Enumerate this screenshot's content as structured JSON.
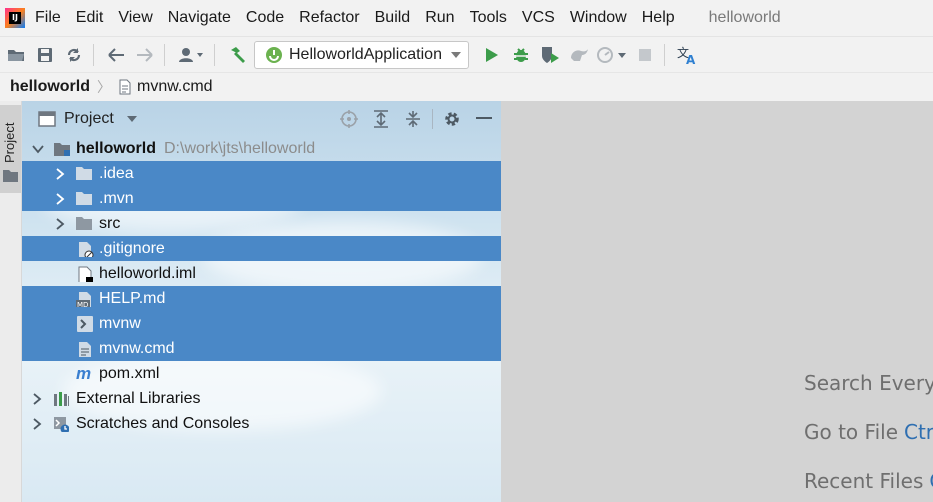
{
  "menubar": {
    "items": [
      "File",
      "Edit",
      "View",
      "Navigate",
      "Code",
      "Refactor",
      "Build",
      "Run",
      "Tools",
      "VCS",
      "Window",
      "Help"
    ],
    "window_title": "helloworld"
  },
  "toolbar": {
    "run_config": "HelloworldApplication"
  },
  "breadcrumb": {
    "project": "helloworld",
    "file": "mvnw.cmd"
  },
  "side_strip": {
    "tab_label": "Project"
  },
  "project_panel": {
    "title": "Project",
    "root": {
      "name": "helloworld",
      "path": "D:\\work\\jts\\helloworld"
    },
    "items": [
      {
        "label": ".idea",
        "type": "folder",
        "selected": true
      },
      {
        "label": ".mvn",
        "type": "folder",
        "selected": true
      },
      {
        "label": "src",
        "type": "folder",
        "selected": false
      },
      {
        "label": ".gitignore",
        "type": "gitignore",
        "selected": true
      },
      {
        "label": "helloworld.iml",
        "type": "iml",
        "selected": false
      },
      {
        "label": "HELP.md",
        "type": "md",
        "selected": true
      },
      {
        "label": "mvnw",
        "type": "script",
        "selected": true
      },
      {
        "label": "mvnw.cmd",
        "type": "text",
        "selected": true
      },
      {
        "label": "pom.xml",
        "type": "maven",
        "selected": false
      }
    ],
    "external_libraries": "External Libraries",
    "scratches": "Scratches and Consoles"
  },
  "editor": {
    "hints": [
      {
        "text": "Search Everywhere",
        "key": ""
      },
      {
        "text": "Go to File",
        "key": "Ctrl"
      },
      {
        "text": "Recent Files",
        "key": "Ctrl"
      }
    ]
  },
  "colors": {
    "selection": "#4a88c7",
    "run_green": "#3c9c4a",
    "link_blue": "#2f6fb1"
  }
}
